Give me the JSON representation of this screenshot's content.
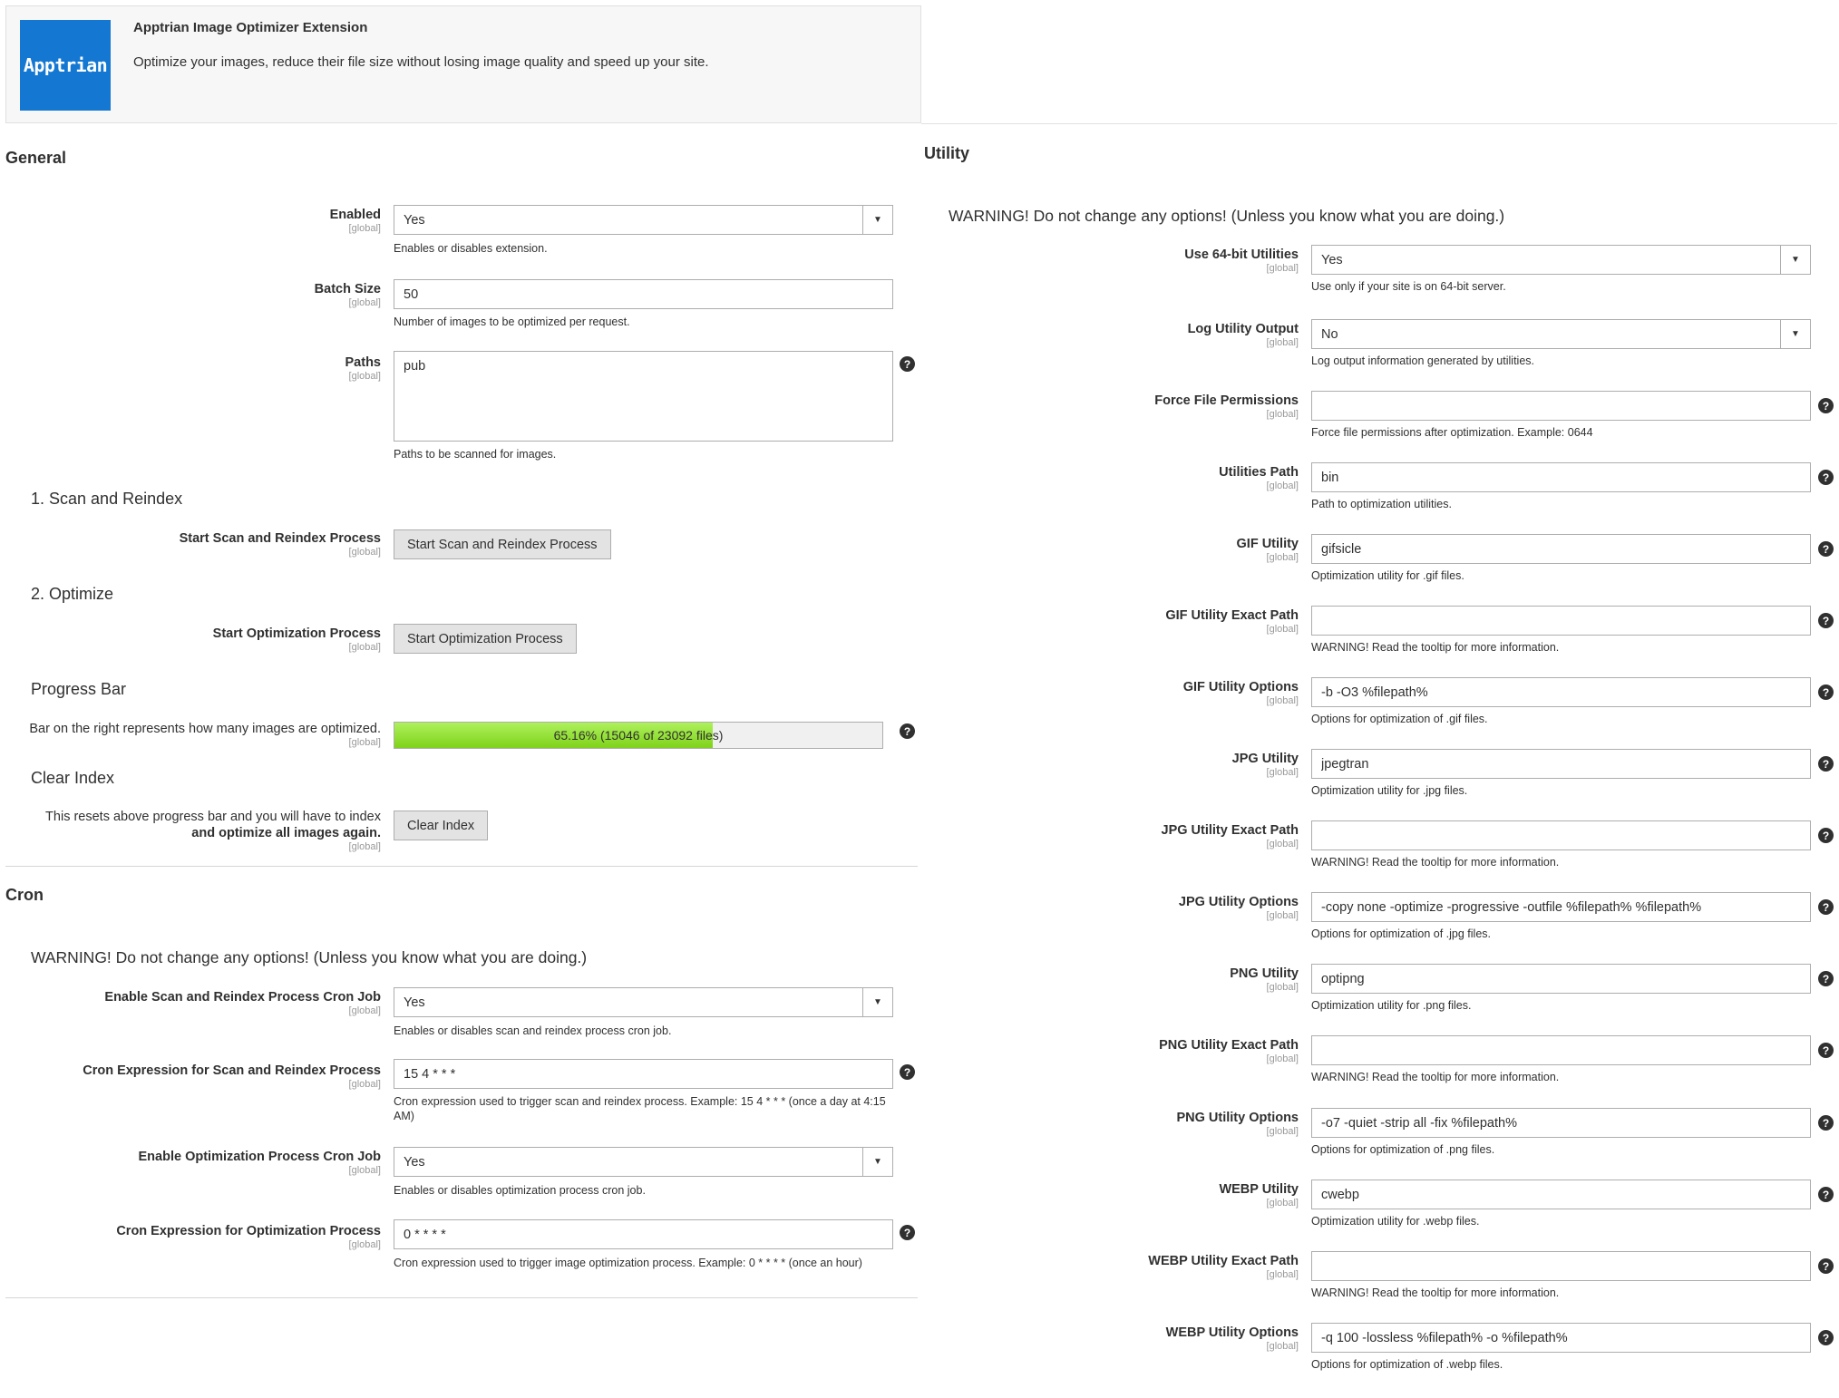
{
  "header": {
    "logo_text": "Apptrian",
    "title": "Apptrian Image Optimizer Extension",
    "description": "Optimize your images, reduce their file size without losing image quality and speed up your site."
  },
  "scope_label": "[global]",
  "general": {
    "title": "General",
    "enabled": {
      "label": "Enabled",
      "value": "Yes",
      "hint": "Enables or disables extension."
    },
    "batch_size": {
      "label": "Batch Size",
      "value": "50",
      "hint": "Number of images to be optimized per request."
    },
    "paths": {
      "label": "Paths",
      "value": "pub",
      "hint": "Paths to be scanned for images."
    },
    "scan": {
      "title": "1. Scan and Reindex",
      "label": "Start Scan and Reindex Process",
      "button": "Start Scan and Reindex Process"
    },
    "optimize": {
      "title": "2. Optimize",
      "label": "Start Optimization Process",
      "button": "Start Optimization Process"
    },
    "progress": {
      "title": "Progress Bar",
      "label": "Bar on the right represents how many images are optimized.",
      "text": "65.16% (15046 of 23092 files)",
      "percent": 65.16
    },
    "clear": {
      "title": "Clear Index",
      "label_line1": "This resets above progress bar and you will have to index",
      "label_line2": "and optimize all images again.",
      "button": "Clear Index"
    }
  },
  "cron": {
    "title": "Cron",
    "warning": "WARNING! Do not change any options! (Unless you know what you are doing.)",
    "scan_cron": {
      "label": "Enable Scan and Reindex Process Cron Job",
      "value": "Yes",
      "hint": "Enables or disables scan and reindex process cron job."
    },
    "scan_expr": {
      "label": "Cron Expression for Scan and Reindex Process",
      "value": "15 4 * * *",
      "hint_line1": "Cron expression used to trigger scan and reindex process. Example: 15 4 * * * (once a day at 4:15",
      "hint_line2": "AM)"
    },
    "opt_cron": {
      "label": "Enable Optimization Process Cron Job",
      "value": "Yes",
      "hint": "Enables or disables optimization process cron job."
    },
    "opt_expr": {
      "label": "Cron Expression for Optimization Process",
      "value": "0 * * * *",
      "hint": "Cron expression used to trigger image optimization process. Example: 0 * * * * (once an hour)"
    }
  },
  "utility": {
    "title": "Utility",
    "warning": "WARNING! Do not change any options! (Unless you know what you are doing.)",
    "use64": {
      "label": "Use 64-bit Utilities",
      "value": "Yes",
      "hint": "Use only if your site is on 64-bit server."
    },
    "log_output": {
      "label": "Log Utility Output",
      "value": "No",
      "hint": "Log output information generated by utilities."
    },
    "force_perm": {
      "label": "Force File Permissions",
      "value": "",
      "hint": "Force file permissions after optimization. Example: 0644"
    },
    "util_path": {
      "label": "Utilities Path",
      "value": "bin",
      "hint": "Path to optimization utilities."
    },
    "gif_util": {
      "label": "GIF Utility",
      "value": "gifsicle",
      "hint": "Optimization utility for .gif files."
    },
    "gif_exact": {
      "label": "GIF Utility Exact Path",
      "value": "",
      "hint": "WARNING! Read the tooltip for more information."
    },
    "gif_opts": {
      "label": "GIF Utility Options",
      "value": "-b -O3 %filepath%",
      "hint": "Options for optimization of .gif files."
    },
    "jpg_util": {
      "label": "JPG Utility",
      "value": "jpegtran",
      "hint": "Optimization utility for .jpg files."
    },
    "jpg_exact": {
      "label": "JPG Utility Exact Path",
      "value": "",
      "hint": "WARNING! Read the tooltip for more information."
    },
    "jpg_opts": {
      "label": "JPG Utility Options",
      "value": "-copy none -optimize -progressive -outfile %filepath% %filepath%",
      "hint": "Options for optimization of .jpg files."
    },
    "png_util": {
      "label": "PNG Utility",
      "value": "optipng",
      "hint": "Optimization utility for .png files."
    },
    "png_exact": {
      "label": "PNG Utility Exact Path",
      "value": "",
      "hint": "WARNING! Read the tooltip for more information."
    },
    "png_opts": {
      "label": "PNG Utility Options",
      "value": "-o7 -quiet -strip all -fix %filepath%",
      "hint": "Options for optimization of .png files."
    },
    "webp_util": {
      "label": "WEBP Utility",
      "value": "cwebp",
      "hint": "Optimization utility for .webp files."
    },
    "webp_exact": {
      "label": "WEBP Utility Exact Path",
      "value": "",
      "hint": "WARNING! Read the tooltip for more information."
    },
    "webp_opts": {
      "label": "WEBP Utility Options",
      "value": "-q 100 -lossless %filepath% -o %filepath%",
      "hint": "Options for optimization of .webp files."
    }
  },
  "icons": {
    "help": "help-icon",
    "dropdown": "chevron-down-icon"
  }
}
